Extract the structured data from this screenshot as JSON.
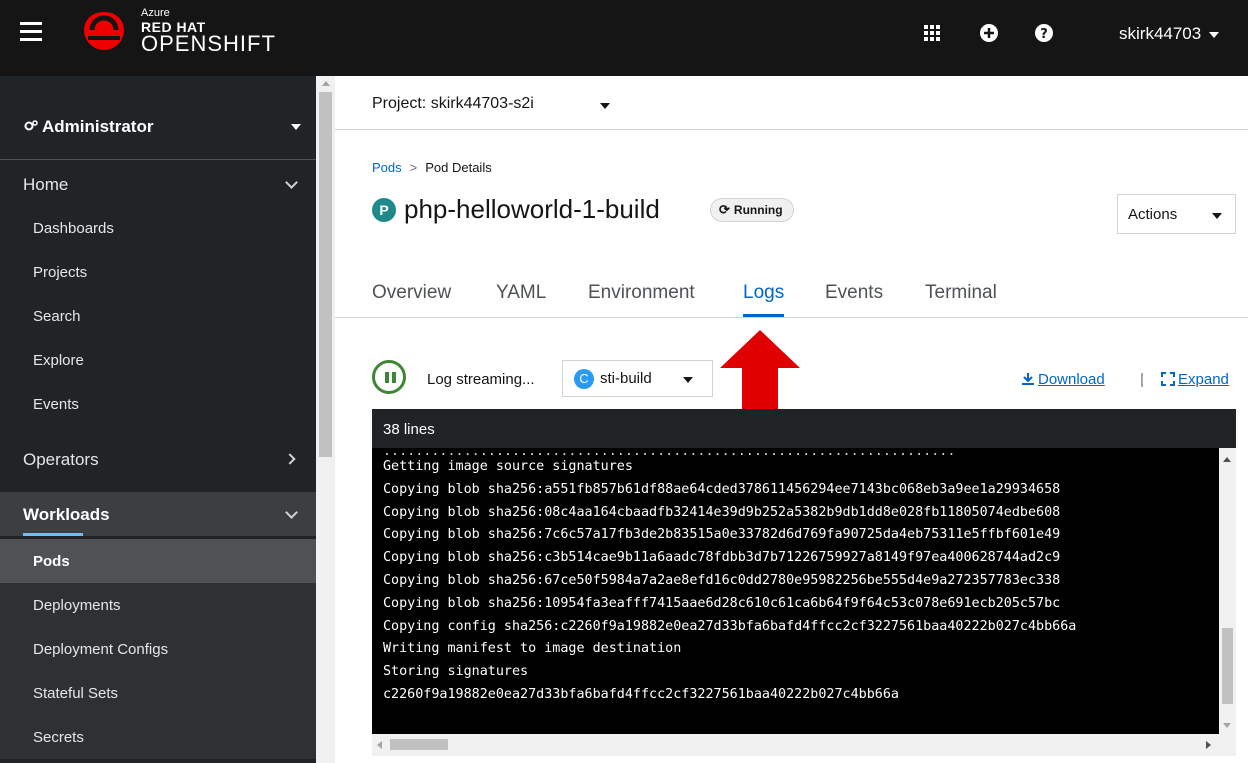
{
  "masthead": {
    "brand_azure": "Azure",
    "brand_redhat": "RED HAT",
    "brand_openshift": "OPENSHIFT",
    "brand_color": "#ee0000",
    "icons": [
      "apps-grid-icon",
      "plus-circle-icon",
      "help-icon"
    ],
    "username": "skirk44703"
  },
  "sidebar": {
    "perspective": "Administrator",
    "sections": {
      "home": "Home",
      "operators": "Operators",
      "workloads": "Workloads"
    },
    "home_items": [
      "Dashboards",
      "Projects",
      "Search",
      "Explore",
      "Events"
    ],
    "workload_items": [
      "Pods",
      "Deployments",
      "Deployment Configs",
      "Stateful Sets",
      "Secrets"
    ],
    "current_item": "Pods"
  },
  "project": {
    "label": "Project: skirk44703-s2i"
  },
  "breadcrumb": {
    "parent": "Pods",
    "current": "Pod Details"
  },
  "pod": {
    "badge": "P",
    "name": "php-helloworld-1-build",
    "status": "Running",
    "actions_label": "Actions"
  },
  "tabs": {
    "items": [
      "Overview",
      "YAML",
      "Environment",
      "Logs",
      "Events",
      "Terminal"
    ],
    "active": "Logs"
  },
  "logs": {
    "streaming_label": "Log streaming...",
    "container_badge": "C",
    "container_name": "sti-build",
    "download_label": "Download",
    "separator": "|",
    "expand_label": "Expand",
    "line_count": "38 lines",
    "lines": [
      "Getting image source signatures",
      "Copying blob sha256:a551fb857b61df88ae64cded378611456294ee7143bc068eb3a9ee1a29934658",
      "Copying blob sha256:08c4aa164cbaadfb32414e39d9b252a5382b9db1dd8e028fb11805074edbe608",
      "Copying blob sha256:7c6c57a17fb3de2b83515a0e33782d6d769fa90725da4eb75311e5ffbf601e49",
      "Copying blob sha256:c3b514cae9b11a6aadc78fdbb3d7b71226759927a8149f97ea400628744ad2c9",
      "Copying blob sha256:67ce50f5984a7a2ae8efd16c0dd2780e95982256be555d4e9a272357783ec338",
      "Copying blob sha256:10954fa3eafff7415aae6d28c610c61ca6b64f9f64c53c078e691ecb205c57bc",
      "Copying config sha256:c2260f9a19882e0ea27d33bfa6bafd4ffcc2cf3227561baa40222b027c4bb66a",
      "Writing manifest to image destination",
      "Storing signatures",
      "c2260f9a19882e0ea27d33bfa6bafd4ffcc2cf3227561baa40222b027c4bb66a"
    ]
  },
  "colors": {
    "accent": "#0066cc",
    "running_green": "#3e8635",
    "annotation_arrow": "#e00000"
  }
}
